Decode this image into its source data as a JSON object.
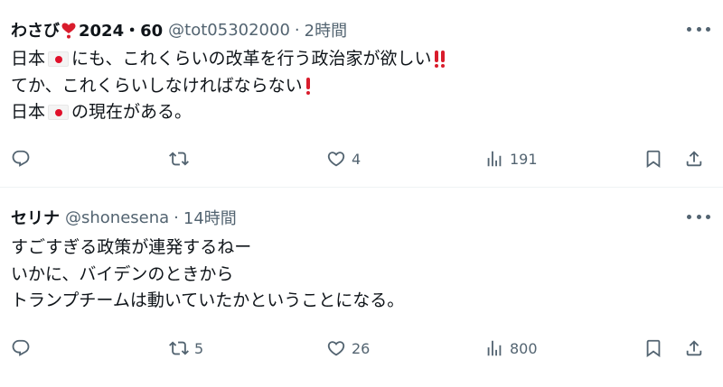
{
  "tweets": [
    {
      "display_name": "わさび",
      "name_suffix": "2024・60",
      "handle": "@tot05302000",
      "separator": "·",
      "time": "2時間",
      "lines": [
        {
          "pre": "日本",
          "post": "にも、これくらいの改革を行う政治家が欲しい"
        },
        {
          "pre": "てか、これくらいしなければならない",
          "post": ""
        },
        {
          "pre": "日本",
          "post": "の現在がある。"
        }
      ],
      "actions": {
        "reply": "",
        "retweet": "",
        "like": "4",
        "views": "191"
      }
    },
    {
      "display_name": "セリナ",
      "handle": "@shonesena",
      "separator": "·",
      "time": "14時間",
      "lines": [
        "すごすぎる政策が連発するねー",
        "いかに、バイデンのときから",
        "トランプチームは動いていたかということになる。"
      ],
      "actions": {
        "reply": "",
        "retweet": "5",
        "like": "26",
        "views": "800"
      }
    }
  ],
  "icons": {
    "reply": "reply-icon",
    "retweet": "retweet-icon",
    "like": "heart-icon",
    "views": "views-icon",
    "bookmark": "bookmark-icon",
    "share": "share-icon",
    "more": "more-icon",
    "flag": "japan-flag-icon"
  },
  "colors": {
    "text": "#0f1419",
    "secondary": "#536471",
    "divider": "#eff3f4",
    "emoji_red": "#d91c2c"
  }
}
